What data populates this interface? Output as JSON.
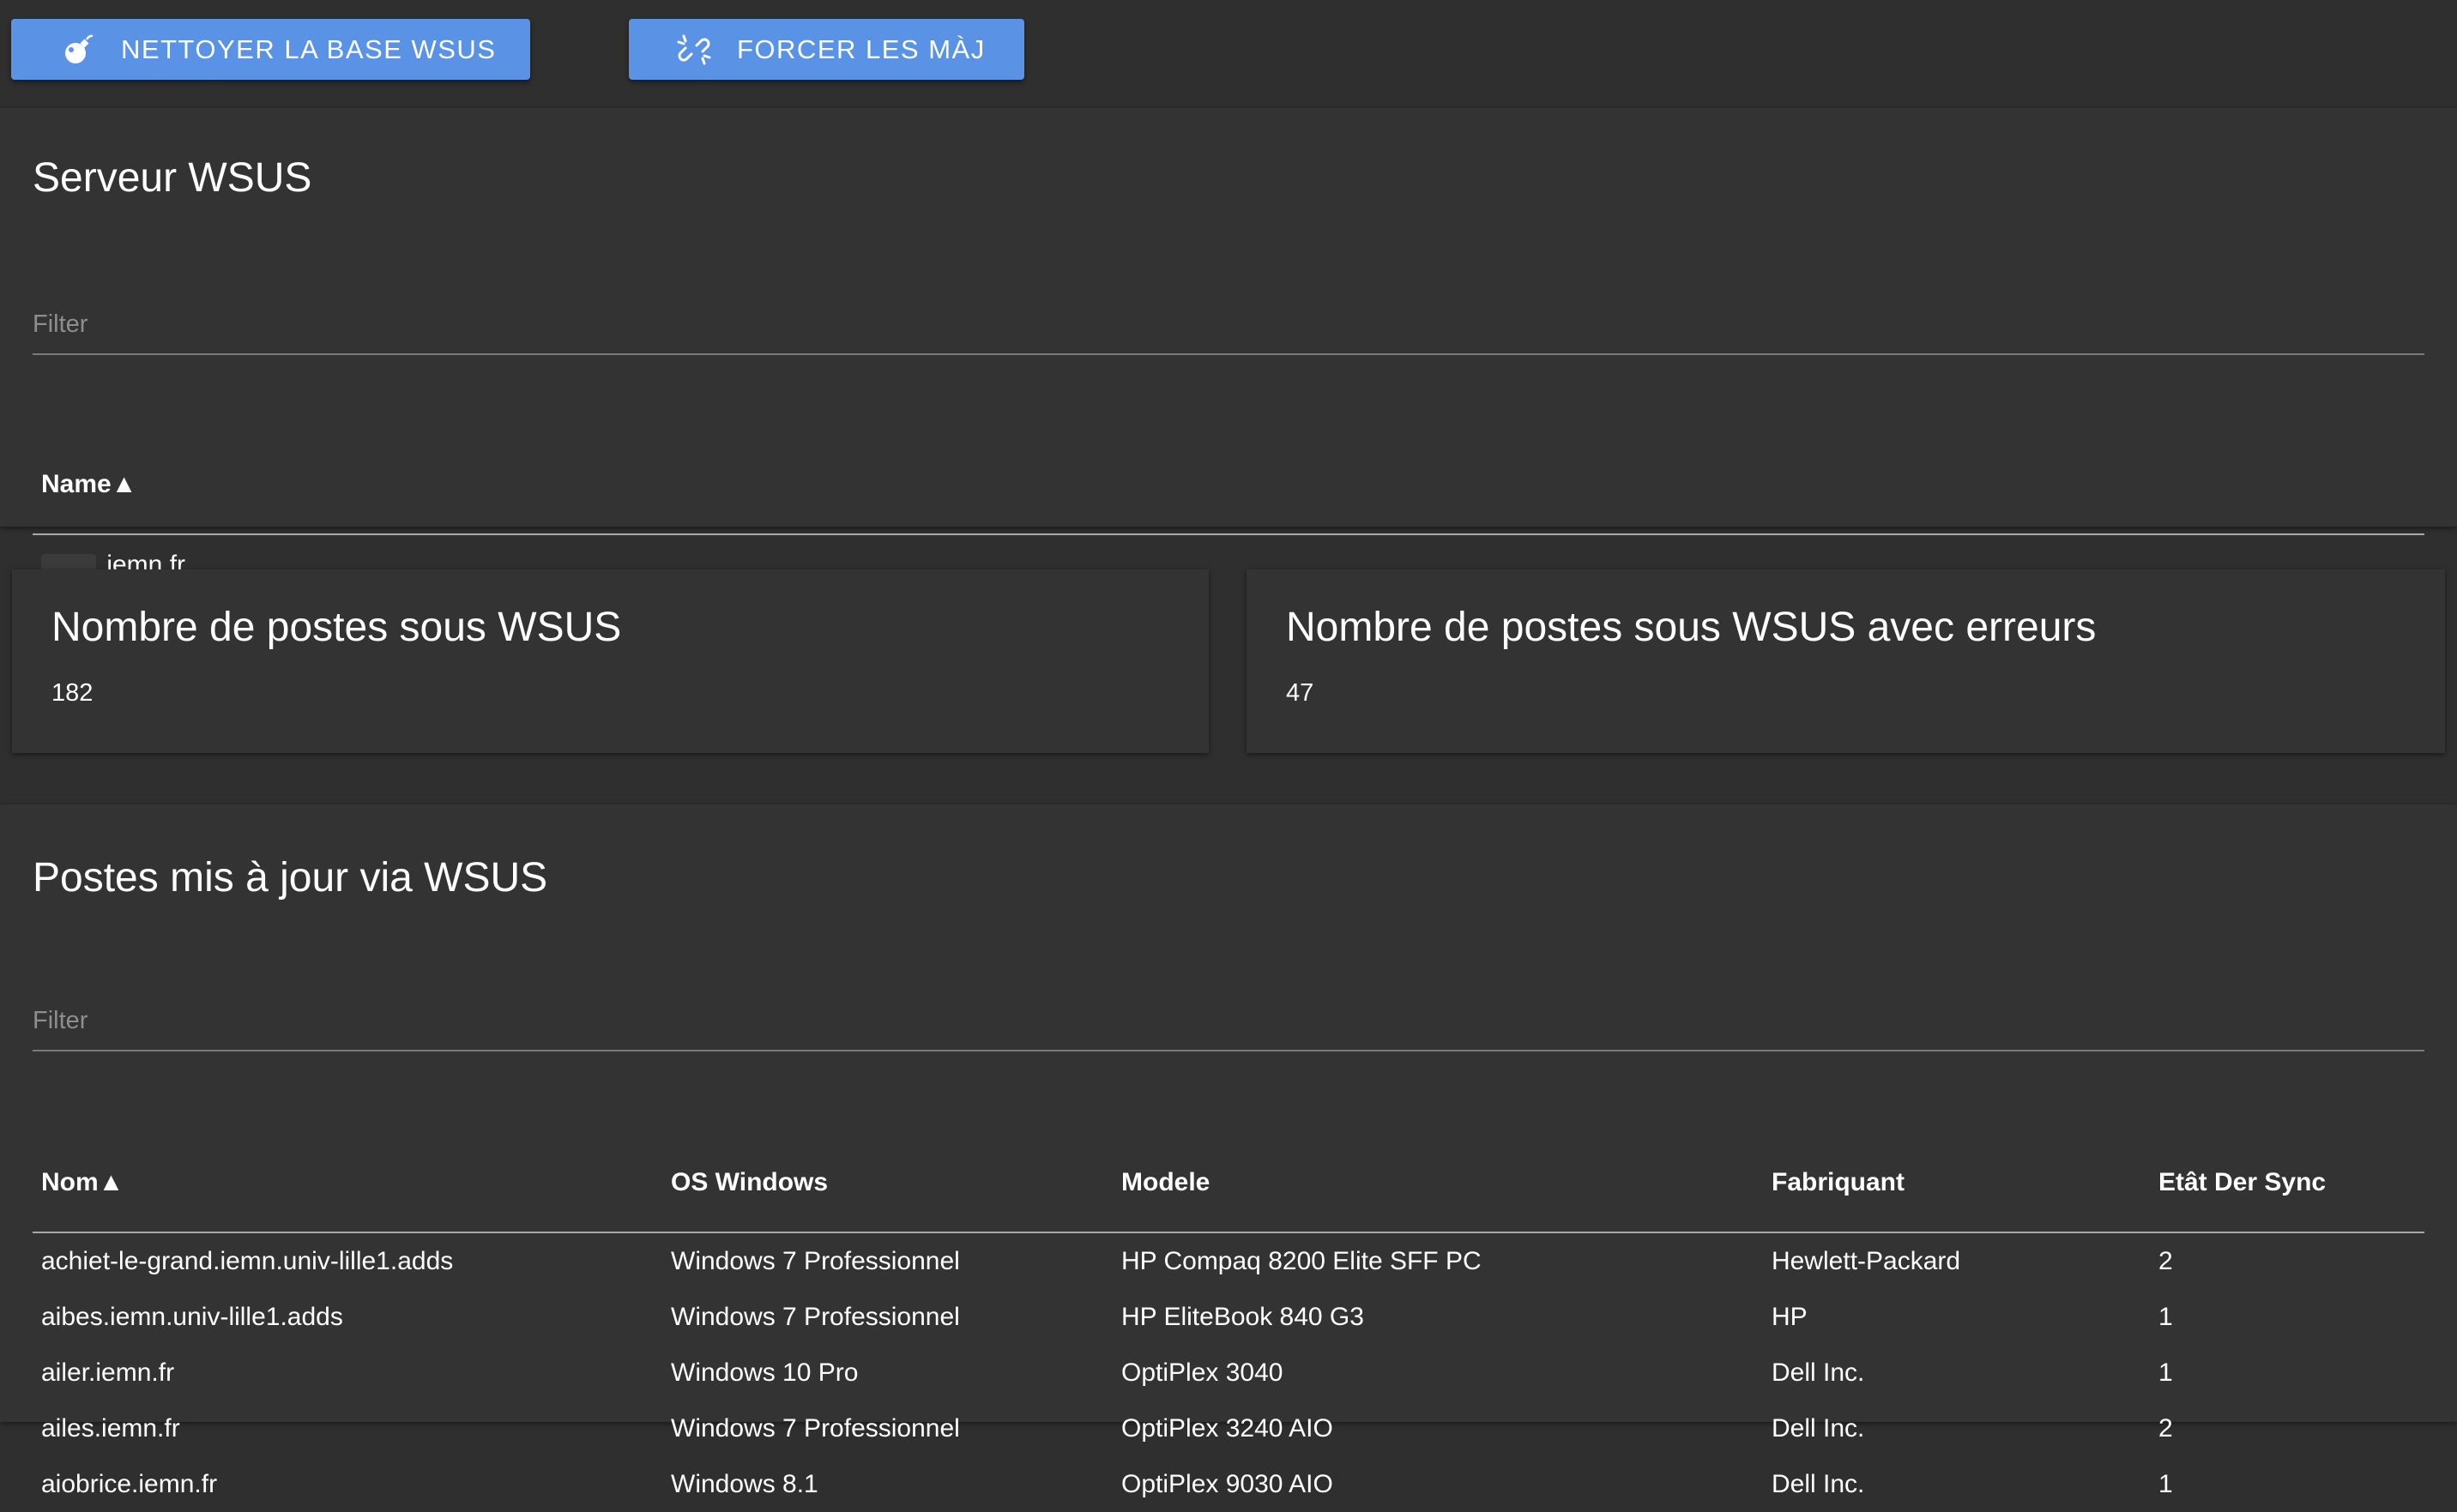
{
  "toolbar": {
    "clean_button": {
      "label": "NETTOYER LA BASE WSUS",
      "icon": "bomb-icon"
    },
    "force_button": {
      "label": "FORCER LES MÀJ",
      "icon": "unlink-icon"
    }
  },
  "server_panel": {
    "title": "Serveur WSUS",
    "filter_placeholder": "Filter",
    "column_name": "Name▲",
    "rows": [
      {
        "name": ".iemn.fr"
      }
    ]
  },
  "stats": [
    {
      "title": "Nombre de postes sous WSUS",
      "value": "182"
    },
    {
      "title": "Nombre de postes sous WSUS avec erreurs",
      "value": "47"
    }
  ],
  "hosts_panel": {
    "title": "Postes mis à jour via WSUS",
    "filter_placeholder": "Filter",
    "columns": [
      "Nom▲",
      "OS Windows",
      "Modele",
      "Fabriquant",
      "Etât Der Sync"
    ],
    "rows": [
      [
        "achiet-le-grand.iemn.univ-lille1.adds",
        "Windows 7 Professionnel",
        "HP Compaq 8200 Elite SFF PC",
        "Hewlett-Packard",
        "2"
      ],
      [
        "aibes.iemn.univ-lille1.adds",
        "Windows 7 Professionnel",
        "HP EliteBook 840 G3",
        "HP",
        "1"
      ],
      [
        "ailer.iemn.fr",
        "Windows 10 Pro",
        "OptiPlex 3040",
        "Dell Inc.",
        "1"
      ],
      [
        "ailes.iemn.fr",
        "Windows 7 Professionnel",
        "OptiPlex 3240 AIO",
        "Dell Inc.",
        "2"
      ],
      [
        "aiobrice.iemn.fr",
        "Windows 8.1",
        "OptiPlex 9030 AIO",
        "Dell Inc.",
        "1"
      ]
    ]
  },
  "colors": {
    "background": "#2f2f2f",
    "card": "#333333",
    "button": "#5a93e6",
    "text": "#ffffff",
    "muted": "#8e8e8e"
  }
}
